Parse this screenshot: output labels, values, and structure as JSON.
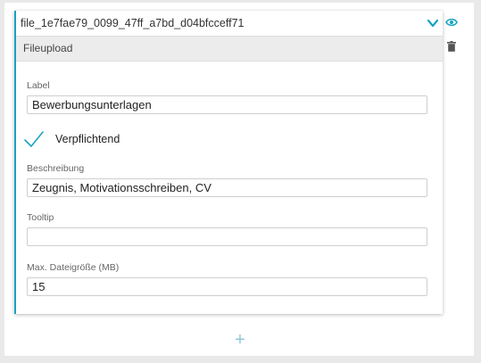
{
  "card": {
    "id": "file_1e7fae79_0099_47ff_a7bd_d04bfcceff71",
    "type_label": "Fileupload"
  },
  "fields": {
    "label": {
      "label": "Label",
      "value": "Bewerbungsunterlagen"
    },
    "required": {
      "label": "Verpflichtend",
      "checked": true
    },
    "description": {
      "label": "Beschreibung",
      "value": "Zeugnis, Motivationsschreiben, CV"
    },
    "tooltip": {
      "label": "Tooltip",
      "value": ""
    },
    "max_size": {
      "label": "Max. Dateigröße (MB)",
      "value": "15"
    }
  },
  "add_button": {
    "glyph": "+"
  },
  "icons": {
    "collapse": "chevron-down-icon",
    "preview": "eye-icon",
    "delete": "trash-icon",
    "check": "checkmark-icon"
  },
  "colors": {
    "accent": "#1aa3c3",
    "add_button": "#8fc4d8"
  }
}
